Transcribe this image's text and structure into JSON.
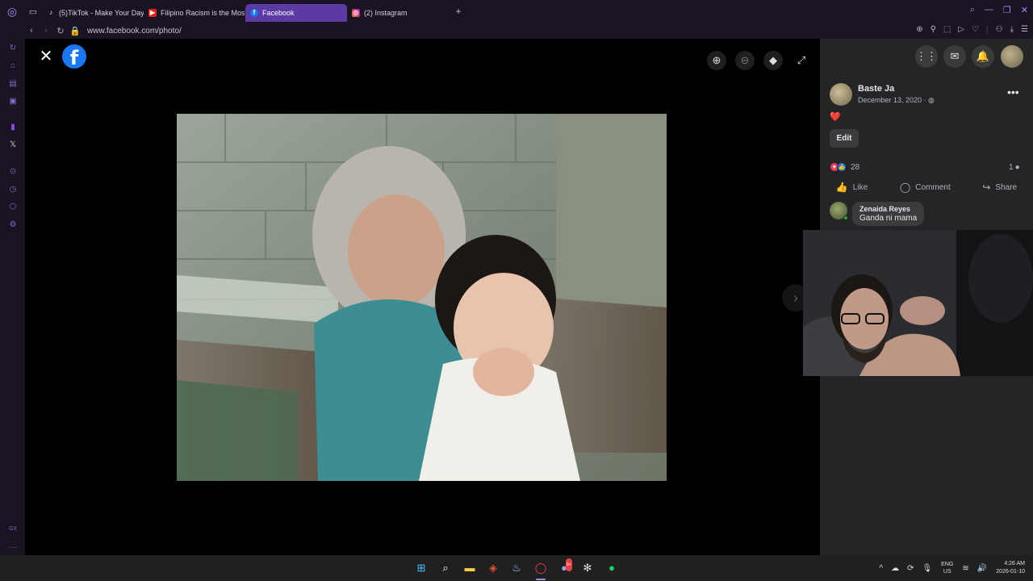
{
  "browser": {
    "tabs": [
      {
        "label": "(5)TikTok - Make Your Day",
        "icon": "tiktok-icon",
        "active": false
      },
      {
        "label": "Filipino Racism is the Mos",
        "icon": "youtube-icon",
        "active": false
      },
      {
        "label": "Facebook",
        "icon": "facebook-icon",
        "active": true
      },
      {
        "label": "(2) Instagram",
        "icon": "instagram-icon",
        "active": false
      }
    ],
    "url": "www.facebook.com/photo/",
    "accent": "#5b3aa4"
  },
  "viewer": {
    "logo": "f",
    "tools": [
      "zoom-in-icon",
      "zoom-out-icon",
      "tag-icon",
      "fullscreen-icon"
    ]
  },
  "post": {
    "author": "Baste Ja",
    "date": "December 13, 2020 · ",
    "text": "❤️",
    "edit_label": "Edit",
    "reaction_count": "28",
    "comment_count": "1",
    "actions": {
      "like": "Like",
      "comment": "Comment",
      "share": "Share"
    },
    "comment": {
      "author": "Zenaida Reyes",
      "text": "Ganda ni mama"
    }
  },
  "taskbar": {
    "lang_1": "ENG",
    "lang_2": "US",
    "time": "4:26 AM",
    "date": "2026-01-10",
    "discord_badge": "9+"
  },
  "sidebar": {
    "bottom_label": "GX"
  }
}
